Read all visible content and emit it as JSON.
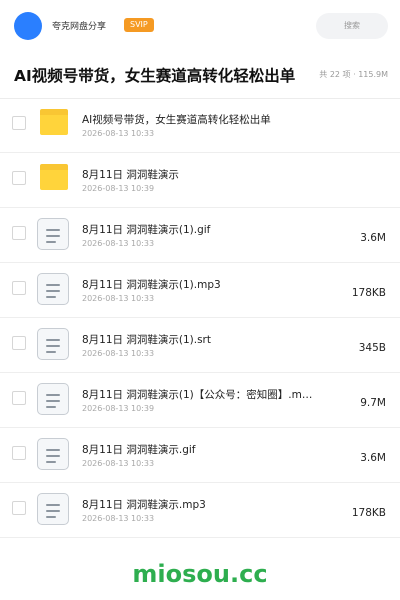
{
  "header": {
    "share_name": "夸克网盘分享",
    "badge": "SVIP",
    "search_label": "搜索",
    "colors": {
      "avatar": "#2a7fff",
      "badge": "#f59a23"
    }
  },
  "folder": {
    "title": "AI视频号带货，女生赛道高转化轻松出单",
    "count_text": "共 22 项 · 115.9M"
  },
  "files": [
    {
      "type": "folder",
      "icon": "folder-icon",
      "name": "AI视频号带货，女生赛道高转化轻松出单",
      "date": "2026-08-13 10:33",
      "size": ""
    },
    {
      "type": "folder",
      "icon": "folder-icon",
      "name": "8月11日 洞洞鞋演示",
      "date": "2026-08-13 10:39",
      "size": ""
    },
    {
      "type": "file",
      "icon": "document-icon",
      "name": "8月11日 洞洞鞋演示(1).gif",
      "date": "2026-08-13 10:33",
      "size": "3.6M"
    },
    {
      "type": "file",
      "icon": "document-icon",
      "name": "8月11日 洞洞鞋演示(1).mp3",
      "date": "2026-08-13 10:33",
      "size": "178KB"
    },
    {
      "type": "file",
      "icon": "document-icon",
      "name": "8月11日 洞洞鞋演示(1).srt",
      "date": "2026-08-13 10:33",
      "size": "345B"
    },
    {
      "type": "file",
      "icon": "document-icon",
      "name": "8月11日 洞洞鞋演示(1)【公众号：密知圈】.m…",
      "date": "2026-08-13 10:39",
      "size": "9.7M"
    },
    {
      "type": "file",
      "icon": "document-icon",
      "name": "8月11日 洞洞鞋演示.gif",
      "date": "2026-08-13 10:33",
      "size": "3.6M"
    },
    {
      "type": "file",
      "icon": "document-icon",
      "name": "8月11日 洞洞鞋演示.mp3",
      "date": "2026-08-13 10:33",
      "size": "178KB"
    }
  ],
  "watermark": "miosou.cc"
}
